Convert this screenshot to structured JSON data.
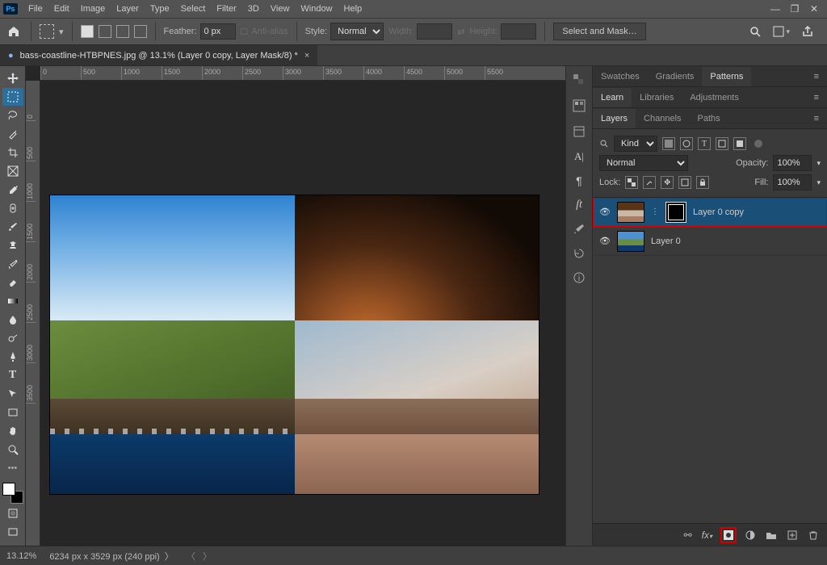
{
  "app": {
    "logo": "Ps"
  },
  "menu": [
    "File",
    "Edit",
    "Image",
    "Layer",
    "Type",
    "Select",
    "Filter",
    "3D",
    "View",
    "Window",
    "Help"
  ],
  "window_controls": {
    "min": "—",
    "max": "❐",
    "close": "✕"
  },
  "optbar": {
    "feather_label": "Feather:",
    "feather_value": "0 px",
    "antialias": "Anti-alias",
    "style_label": "Style:",
    "style_value": "Normal",
    "width_label": "Width:",
    "swap": "⇄",
    "height_label": "Height:",
    "select_mask": "Select and Mask…"
  },
  "doc_tab": {
    "title": "bass-coastline-HTBPNES.jpg @ 13.1% (Layer 0 copy, Layer Mask/8) *",
    "close": "×"
  },
  "ruler_h": [
    "0",
    "500",
    "1000",
    "1500",
    "2000",
    "2500",
    "3000",
    "3500",
    "4000",
    "4500",
    "5000",
    "5500"
  ],
  "ruler_v": [
    "0",
    "500",
    "1000",
    "1500",
    "2000",
    "2500",
    "3000",
    "3500"
  ],
  "midpanel_icons": [
    "color",
    "swatches",
    "libraries",
    "type",
    "glyphs",
    "brush",
    "history",
    "info"
  ],
  "panels": {
    "group1": {
      "tabs": [
        "Swatches",
        "Gradients",
        "Patterns"
      ],
      "active": 2
    },
    "group2": {
      "tabs": [
        "Learn",
        "Libraries",
        "Adjustments"
      ],
      "active": 0
    },
    "layers_group": {
      "tabs": [
        "Layers",
        "Channels",
        "Paths"
      ],
      "active": 0
    }
  },
  "layers_panel": {
    "filter_kind": "Kind",
    "blend_mode": "Normal",
    "opacity_label": "Opacity:",
    "opacity_value": "100%",
    "lock_label": "Lock:",
    "fill_label": "Fill:",
    "fill_value": "100%",
    "layers": [
      {
        "name": "Layer 0 copy",
        "has_mask": true,
        "selected": true
      },
      {
        "name": "Layer 0",
        "has_mask": false,
        "selected": false
      }
    ],
    "footer_icons": [
      "link",
      "fx",
      "mask",
      "adjust",
      "group",
      "new",
      "trash"
    ]
  },
  "status": {
    "zoom": "13.12%",
    "dims": "6234 px x 3529 px (240 ppi)"
  }
}
